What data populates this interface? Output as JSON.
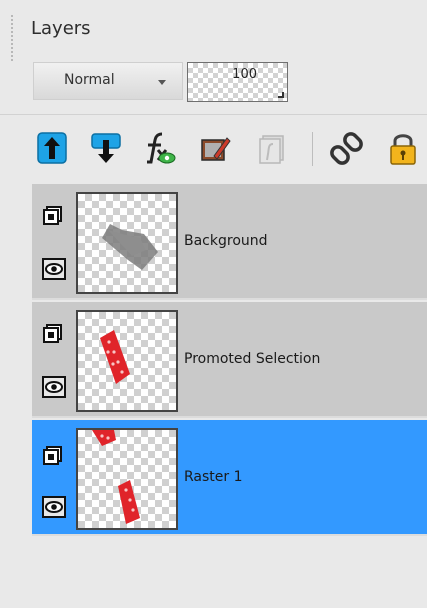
{
  "panel": {
    "title": "Layers"
  },
  "blend_mode": {
    "value": "Normal"
  },
  "opacity": {
    "value": "100"
  },
  "toolbar": [
    {
      "name": "move-layer-up-icon"
    },
    {
      "name": "move-layer-down-icon"
    },
    {
      "name": "layer-effects-icon"
    },
    {
      "name": "edit-selection-icon"
    },
    {
      "name": "layer-mask-icon"
    },
    {
      "name": "link-layers-icon"
    },
    {
      "name": "lock-transparency-icon"
    }
  ],
  "layers": [
    {
      "name": "Background",
      "selected": false,
      "visible": true
    },
    {
      "name": "Promoted Selection",
      "selected": false,
      "visible": true
    },
    {
      "name": "Raster 1",
      "selected": true,
      "visible": true
    }
  ],
  "colors": {
    "selected_row": "#3399ff",
    "normal_row": "#c9c9c9",
    "toolbar_blue": "#1ea3e6",
    "lock_gold": "#f2b41c",
    "selection_red": "#e0242a"
  }
}
